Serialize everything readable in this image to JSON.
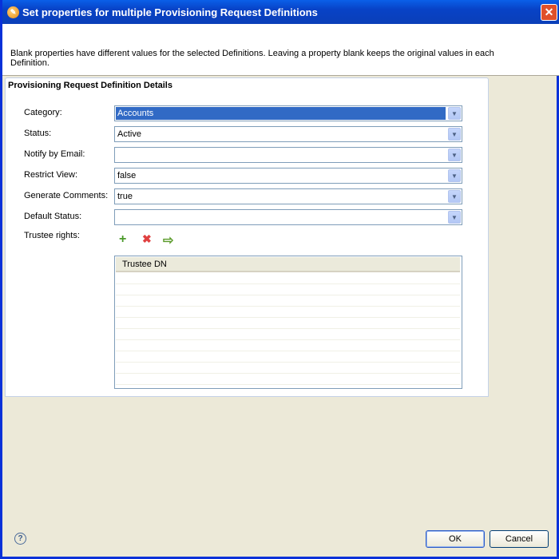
{
  "window": {
    "title": "Set properties for multiple Provisioning Request Definitions",
    "close": "✕"
  },
  "description": "Blank properties have different values for the selected Definitions.  Leaving a property blank keeps the original values in each Definition.",
  "section_title": "Provisioning Request Definition Details",
  "fields": [
    {
      "label": "Category:",
      "value": "Accounts"
    },
    {
      "label": "Status:",
      "value": "Active"
    },
    {
      "label": "Notify by Email:",
      "value": ""
    },
    {
      "label": "Restrict View:",
      "value": "false"
    },
    {
      "label": "Generate Comments:",
      "value": "true"
    },
    {
      "label": "Default Status:",
      "value": ""
    }
  ],
  "trustee": {
    "label": "Trustee rights:",
    "column": "Trustee DN",
    "add": "+",
    "remove": "✖",
    "edit": "⇨"
  },
  "buttons": {
    "ok": "OK",
    "cancel": "Cancel",
    "help": "?"
  }
}
